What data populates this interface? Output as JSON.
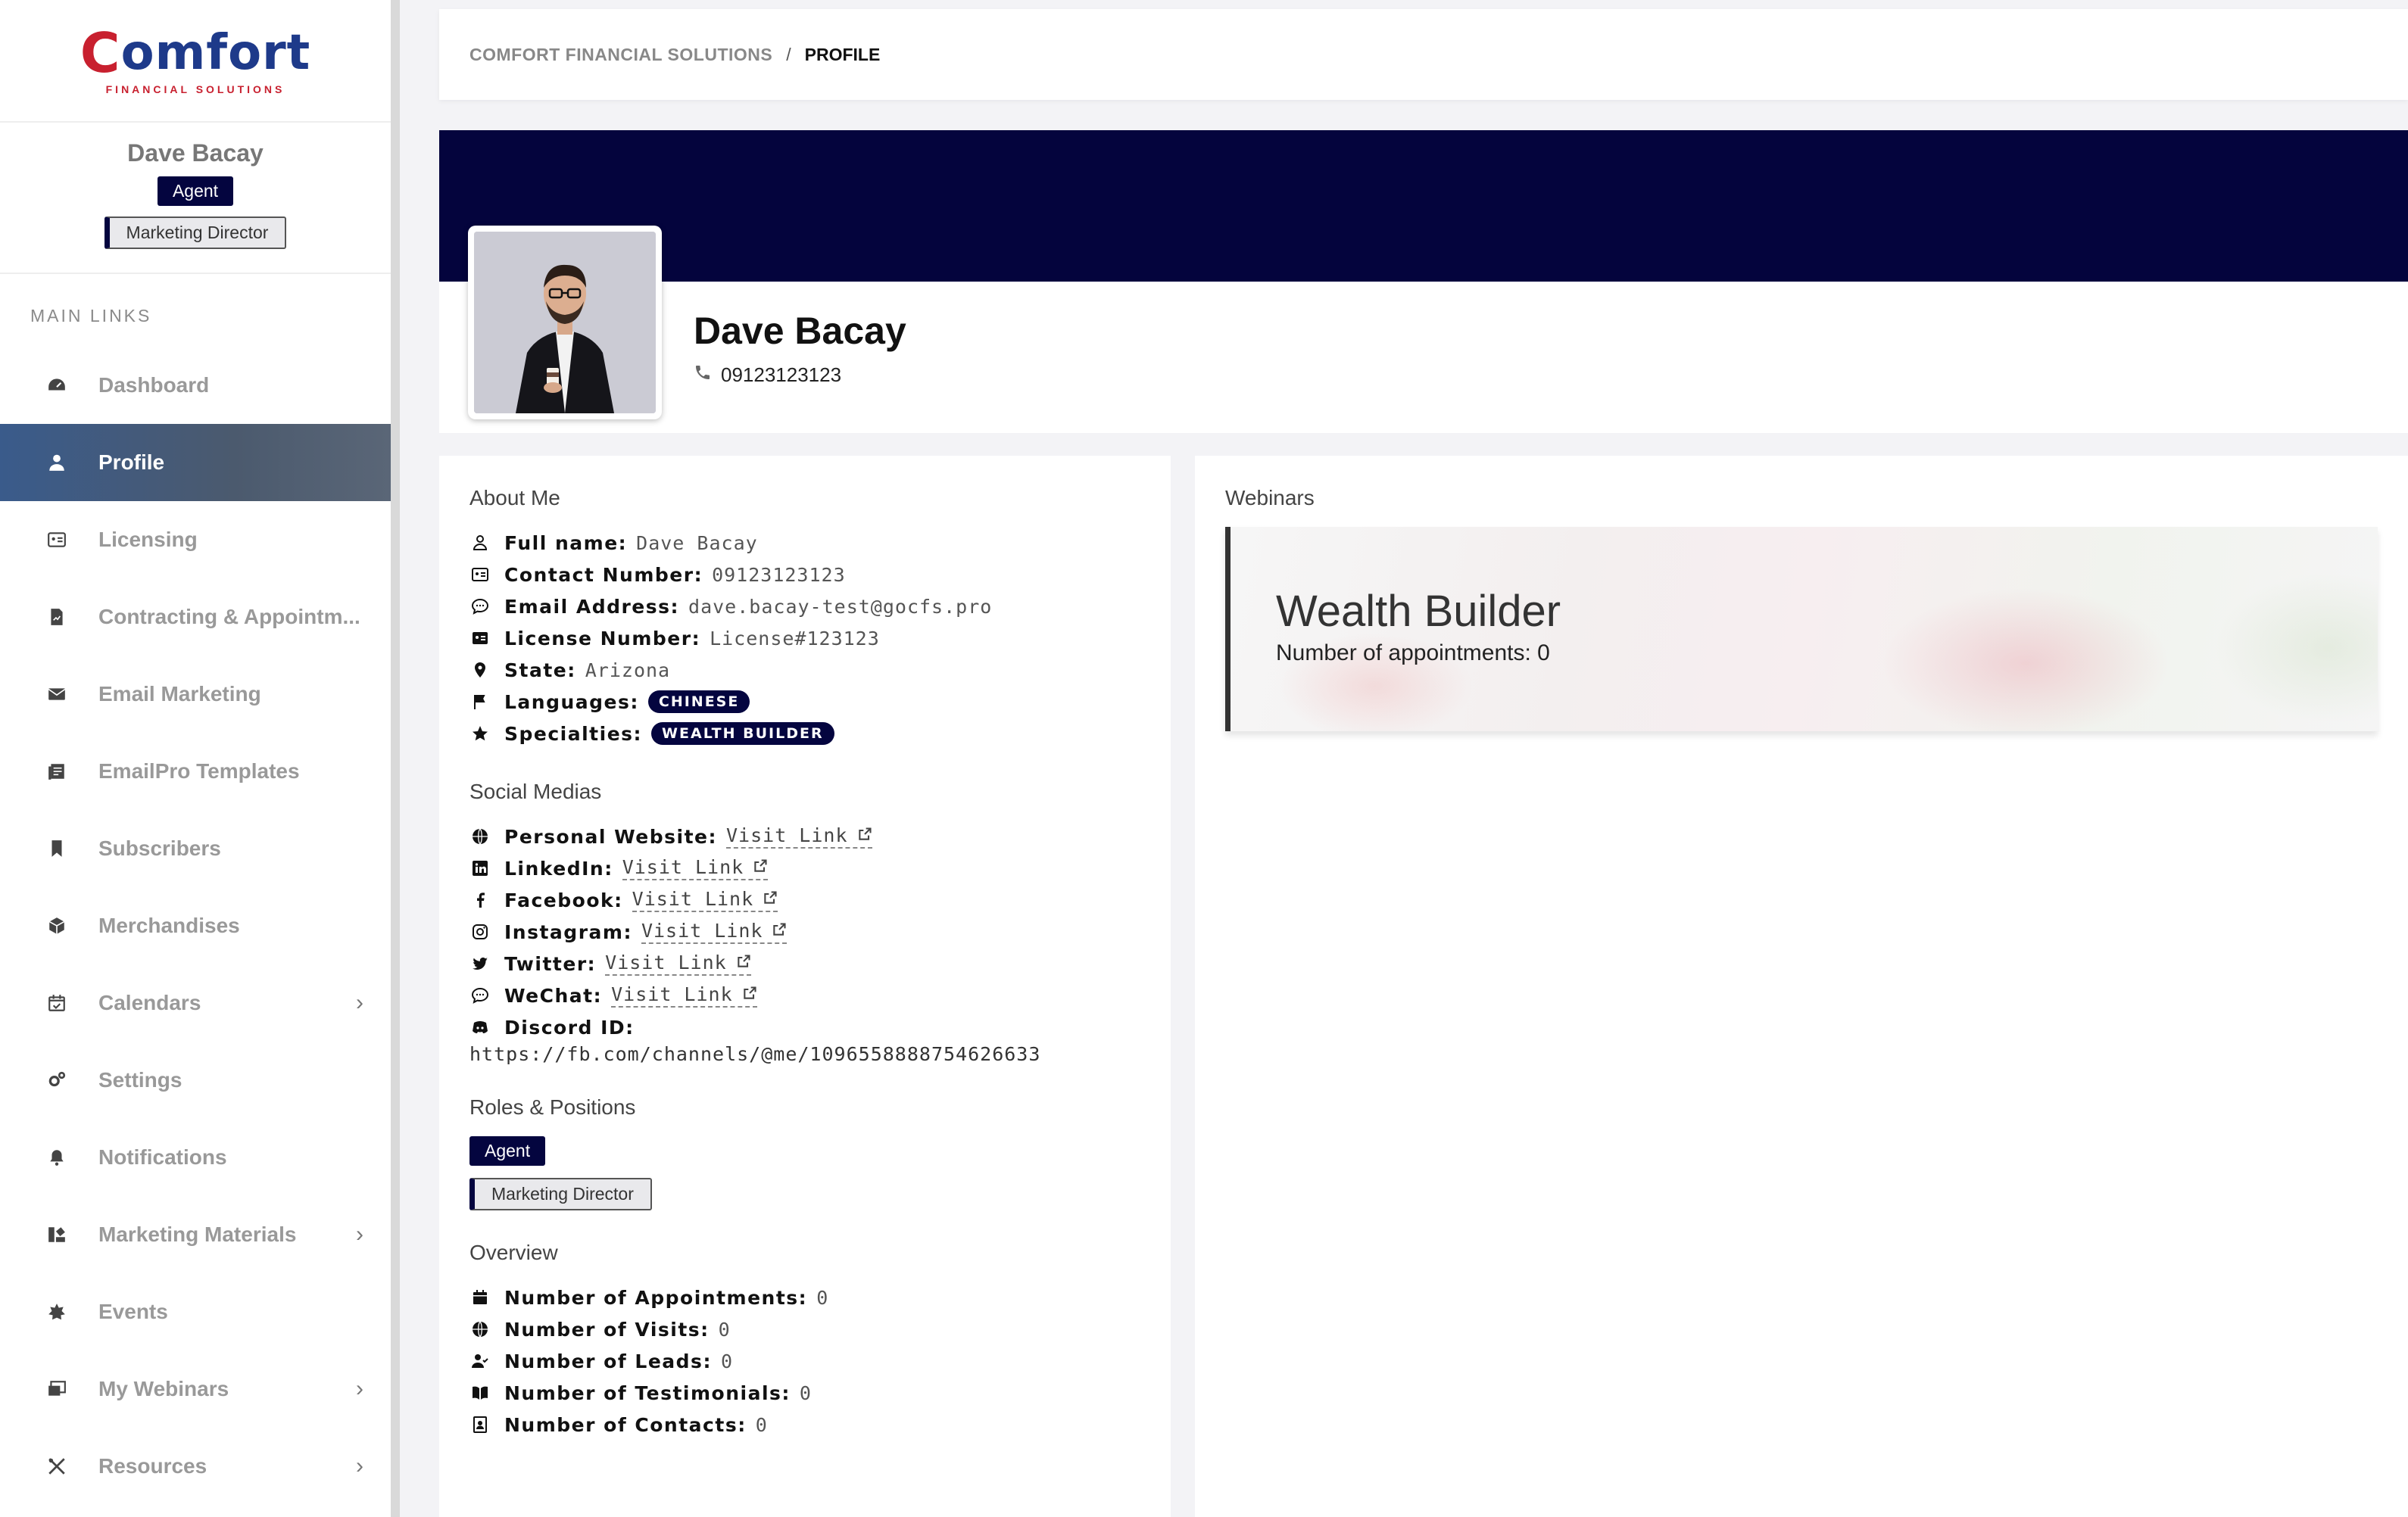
{
  "logo": {
    "brand": "omfort",
    "brand_initial": "C",
    "tagline": "FINANCIAL SOLUTIONS"
  },
  "sidebar": {
    "user_name": "Dave Bacay",
    "role_badge": "Agent",
    "position_badge": "Marketing Director",
    "section_label": "MAIN LINKS",
    "items": [
      {
        "label": "Dashboard",
        "icon": "dashboard-icon",
        "active": false,
        "has_submenu": false
      },
      {
        "label": "Profile",
        "icon": "user-icon",
        "active": true,
        "has_submenu": false
      },
      {
        "label": "Licensing",
        "icon": "id-card-icon",
        "active": false,
        "has_submenu": false
      },
      {
        "label": "Contracting & Appointm...",
        "icon": "file-contract-icon",
        "active": false,
        "has_submenu": false
      },
      {
        "label": "Email Marketing",
        "icon": "envelope-icon",
        "active": false,
        "has_submenu": false
      },
      {
        "label": "EmailPro Templates",
        "icon": "template-icon",
        "active": false,
        "has_submenu": false
      },
      {
        "label": "Subscribers",
        "icon": "bookmark-icon",
        "active": false,
        "has_submenu": false
      },
      {
        "label": "Merchandises",
        "icon": "box-icon",
        "active": false,
        "has_submenu": false
      },
      {
        "label": "Calendars",
        "icon": "calendar-check-icon",
        "active": false,
        "has_submenu": true
      },
      {
        "label": "Settings",
        "icon": "gears-icon",
        "active": false,
        "has_submenu": false
      },
      {
        "label": "Notifications",
        "icon": "bell-icon",
        "active": false,
        "has_submenu": false
      },
      {
        "label": "Marketing Materials",
        "icon": "materials-icon",
        "active": false,
        "has_submenu": true
      },
      {
        "label": "Events",
        "icon": "star-burst-icon",
        "active": false,
        "has_submenu": false
      },
      {
        "label": "My Webinars",
        "icon": "webinar-icon",
        "active": false,
        "has_submenu": true
      },
      {
        "label": "Resources",
        "icon": "tools-icon",
        "active": false,
        "has_submenu": true
      }
    ]
  },
  "breadcrumb": {
    "root": "COMFORT FINANCIAL SOLUTIONS",
    "separator": "/",
    "current": "PROFILE"
  },
  "header": {
    "name": "Dave Bacay",
    "phone": "09123123123"
  },
  "about": {
    "title": "About Me",
    "rows": [
      {
        "icon": "user-outline-icon",
        "label": "Full name:",
        "value": "Dave Bacay"
      },
      {
        "icon": "contact-card-icon",
        "label": "Contact Number:",
        "value": "09123123123"
      },
      {
        "icon": "comment-icon",
        "label": "Email Address:",
        "value": "dave.bacay-test@gocfs.pro"
      },
      {
        "icon": "license-card-icon",
        "label": "License Number:",
        "value": "License#123123"
      },
      {
        "icon": "location-pin-icon",
        "label": "State:",
        "value": "Arizona"
      }
    ],
    "languages_label": "Languages:",
    "languages": [
      "CHINESE"
    ],
    "specialties_label": "Specialties:",
    "specialties": [
      "WEALTH BUILDER"
    ]
  },
  "social": {
    "title": "Social Medias",
    "items": [
      {
        "icon": "globe-icon",
        "label": "Personal Website:",
        "link_text": "Visit Link"
      },
      {
        "icon": "linkedin-icon",
        "label": "LinkedIn:",
        "link_text": "Visit Link"
      },
      {
        "icon": "facebook-icon",
        "label": "Facebook:",
        "link_text": "Visit Link"
      },
      {
        "icon": "instagram-icon",
        "label": "Instagram:",
        "link_text": "Visit Link"
      },
      {
        "icon": "twitter-icon",
        "label": "Twitter:",
        "link_text": "Visit Link"
      },
      {
        "icon": "wechat-icon",
        "label": "WeChat:",
        "link_text": "Visit Link"
      }
    ],
    "discord_label": "Discord ID:",
    "discord_value": "https://fb.com/channels/@me/1096558888754626633"
  },
  "roles": {
    "title": "Roles & Positions",
    "role": "Agent",
    "position": "Marketing Director"
  },
  "overview": {
    "title": "Overview",
    "rows": [
      {
        "icon": "calendar-icon",
        "label": "Number of Appointments:",
        "value": "0"
      },
      {
        "icon": "globe-icon",
        "label": "Number of Visits:",
        "value": "0"
      },
      {
        "icon": "user-check-icon",
        "label": "Number of Leads:",
        "value": "0"
      },
      {
        "icon": "book-open-icon",
        "label": "Number of Testimonials:",
        "value": "0"
      },
      {
        "icon": "address-book-icon",
        "label": "Number of Contacts:",
        "value": "0"
      }
    ]
  },
  "webinars": {
    "title": "Webinars",
    "items": [
      {
        "name": "Wealth Builder",
        "appointments_text": "Number of appointments: 0"
      }
    ]
  },
  "colors": {
    "navy": "#04053f",
    "banner": "#04043d",
    "active_nav": "#3a5b8b",
    "logo_blue": "#1e3a8a",
    "logo_red": "#c8202f"
  }
}
